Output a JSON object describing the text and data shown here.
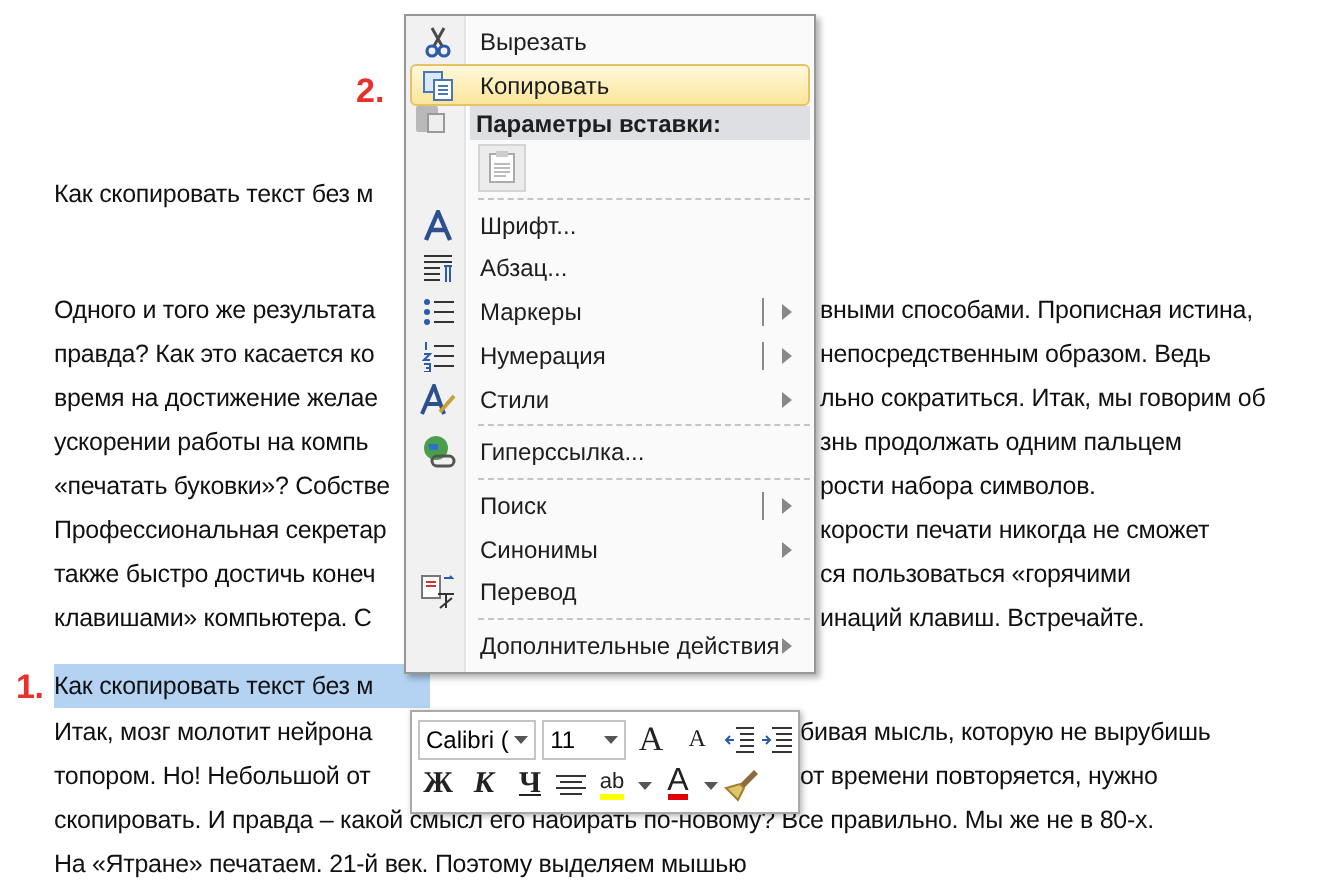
{
  "document": {
    "paragraphs": [
      {
        "kind": "plain",
        "highlighted": false,
        "lines": [
          {
            "left": "Как скопировать текст без м"
          }
        ]
      },
      {
        "kind": "split",
        "highlighted": false,
        "lines": [
          {
            "left": "Одного и того же результата",
            "right": "вными способами. Прописная истина,"
          },
          {
            "left": "правда? Как это касается ко",
            "right": "непосредственным образом. Ведь"
          },
          {
            "left": "время на достижение желае",
            "right": "льно сократиться. Итак, мы говорим об"
          },
          {
            "left": "ускорении работы на компь",
            "right": "знь продолжать одним пальцем"
          },
          {
            "left": "«печатать буковки»?  Собстве",
            "right": "рости набора символов."
          },
          {
            "left": "Профессиональная секретар",
            "right": "корости печати никогда не сможет"
          },
          {
            "left": "также быстро достичь конеч",
            "right": "ся пользоваться «горячими"
          },
          {
            "left": "клавишами» компьютера. С",
            "right": "инаций клавиш. Встречайте."
          }
        ]
      },
      {
        "kind": "plain",
        "highlighted": true,
        "marker": "1.",
        "lines": [
          {
            "left": "Как скопировать текст без м"
          }
        ]
      },
      {
        "kind": "split-narrow",
        "highlighted": false,
        "lines": [
          {
            "left": "Итак, мозг молотит нейрона",
            "right": "бивая мысль, которую не вырубишь"
          },
          {
            "left": "топором. Но! Небольшой от",
            "right": "от времени повторяется, нужно"
          },
          {
            "left": "скопировать. И правда – какой смысл его набирать по-новому? Все правильно. Мы же не в 80-х."
          },
          {
            "left": "На «Ятране» печатаем. 21-й век. Поэтому выделяем мышью"
          }
        ]
      }
    ]
  },
  "menu_marker": "2.",
  "context_menu": {
    "items": [
      {
        "kind": "command",
        "label": "Вырезать",
        "selected": false
      },
      {
        "kind": "command",
        "label": "Копировать",
        "selected": true
      },
      {
        "kind": "header",
        "label": "Параметры вставки:"
      },
      {
        "kind": "paste-options"
      },
      {
        "kind": "separator"
      },
      {
        "kind": "command",
        "label": "Шрифт...",
        "selected": false
      },
      {
        "kind": "command",
        "label": "Абзац...",
        "selected": false
      },
      {
        "kind": "split-submenu",
        "label": "Маркеры",
        "selected": false
      },
      {
        "kind": "split-submenu",
        "label": "Нумерация",
        "selected": false
      },
      {
        "kind": "submenu",
        "label": "Стили",
        "selected": false
      },
      {
        "kind": "separator"
      },
      {
        "kind": "command",
        "label": "Гиперссылка...",
        "selected": false
      },
      {
        "kind": "separator"
      },
      {
        "kind": "split-submenu",
        "label": "Поиск",
        "selected": false
      },
      {
        "kind": "submenu",
        "label": "Синонимы",
        "selected": false
      },
      {
        "kind": "command",
        "label": "Перевод",
        "selected": false
      },
      {
        "kind": "separator"
      },
      {
        "kind": "submenu",
        "label": "Дополнительные действия",
        "selected": false
      }
    ]
  },
  "mini_toolbar": {
    "font": "Calibri (",
    "size": "11",
    "grow_font": "A",
    "shrink_font": "A",
    "bold": "Ж",
    "italic": "К",
    "underline": "Ч",
    "highlight": "ab",
    "font_color": "A"
  }
}
